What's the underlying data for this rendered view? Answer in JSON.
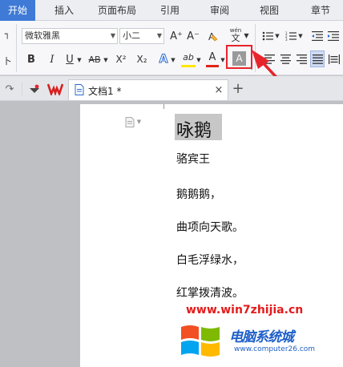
{
  "tabs": [
    "开始",
    "插入",
    "页面布局",
    "引用",
    "审阅",
    "视图",
    "章节"
  ],
  "font": {
    "name": "微软雅黑",
    "size": "小二"
  },
  "icons": {
    "grow_font": "A⁺",
    "shrink_font": "A⁻",
    "clear_format": "clear-format-icon",
    "phonetic_top": "wén",
    "phonetic_bottom": "文",
    "bold": "B",
    "italic": "I",
    "underline": "U",
    "strike": "AB",
    "superscript": "X²",
    "subscript": "X₂",
    "text_effect": "A",
    "highlight": "ab",
    "font_color": "A",
    "char_shading": "A"
  },
  "document": {
    "tab_title": "文档1 *",
    "title": "咏鹅",
    "lines": [
      "骆宾王",
      "鹅鹅鹅，",
      "曲项向天歌。",
      "白毛浮绿水，",
      "红掌拨清波。"
    ]
  },
  "watermark": {
    "url": "www.win7zhijia.cn",
    "site_name": "电脑系统城",
    "site_url": "www.computer26.com"
  },
  "colors": {
    "accent": "#3f7bd6",
    "highlight_red": "#e8242b",
    "highlight_yellow": "#ffe600",
    "font_red": "#e0241b"
  }
}
